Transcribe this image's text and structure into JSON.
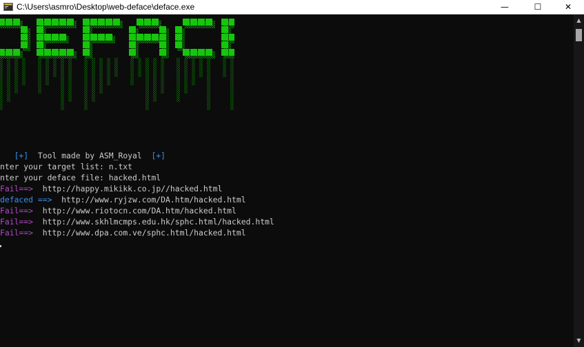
{
  "window": {
    "title": "C:\\Users\\asmro\\Desktop\\web-deface\\deface.exe",
    "minimize_glyph": "—",
    "maximize_glyph": "☐",
    "close_glyph": "✕"
  },
  "banner": {
    "text": "DEFACE",
    "color": "#16c60c",
    "shadow_color": "#0c6a06"
  },
  "console": {
    "credit": {
      "prefix": "[+]",
      "text": "Tool made by ASM_Royal",
      "suffix": "[+]"
    },
    "prompt_target": "nter your target list: n.txt",
    "prompt_deface": "nter your deface file: hacked.html",
    "results": [
      {
        "status": "Fail==>",
        "url": "http://happy.mikikk.co.jp//hacked.html",
        "type": "fail"
      },
      {
        "status": "defaced ==>",
        "url": "http://www.ryjzw.com/DA.htm/hacked.html",
        "type": "defaced"
      },
      {
        "status": "Fail==>",
        "url": "http://www.riotocn.com/DA.htm/hacked.html",
        "type": "fail"
      },
      {
        "status": "Fail==>",
        "url": "http://www.skhlmcmps.edu.hk/sphc.html/hacked.html",
        "type": "fail"
      },
      {
        "status": "Fail==>",
        "url": "http://www.dpa.com.ve/sphc.html/hacked.html",
        "type": "fail"
      }
    ]
  },
  "colors": {
    "fail": "#b148c6",
    "defaced": "#3b8eea",
    "text": "#cccccc",
    "background": "#0c0c0c"
  }
}
